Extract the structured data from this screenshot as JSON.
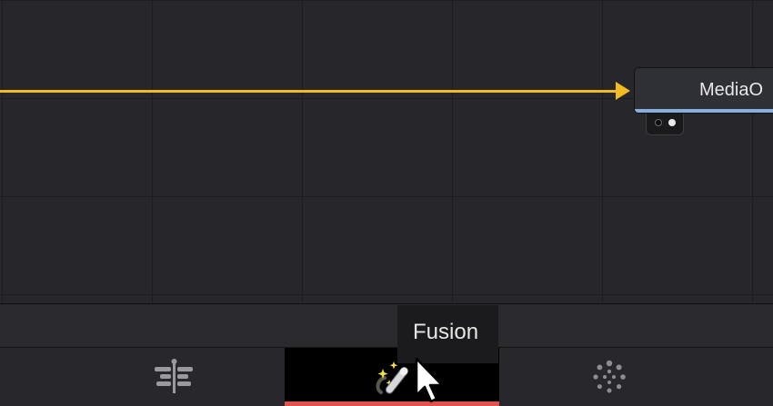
{
  "node_editor": {
    "node": {
      "label": "MediaO"
    }
  },
  "page_bar": {
    "tabs": [
      {
        "name": "edit",
        "icon": "edit-page-icon",
        "active": false
      },
      {
        "name": "fusion",
        "icon": "fusion-page-icon",
        "active": true
      },
      {
        "name": "color",
        "icon": "color-page-icon",
        "active": false
      }
    ],
    "tooltip": "Fusion"
  },
  "colors": {
    "connection": "#f2bb24",
    "node_stripe": "#8aaedc",
    "active_tab_underline": "#e0524b"
  }
}
